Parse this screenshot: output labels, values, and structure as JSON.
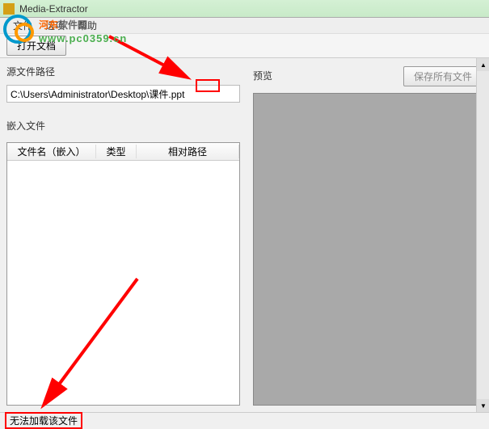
{
  "window": {
    "title": "Media-Extractor"
  },
  "menu": {
    "file": "文件",
    "options": "选项",
    "help": "帮助"
  },
  "toolbar": {
    "open_file": "打开文档",
    "save_all": "保存所有文件"
  },
  "left": {
    "source_path_label": "源文件路径",
    "source_path_value": "C:\\Users\\Administrator\\Desktop\\课件.ppt",
    "embedded_label": "嵌入文件",
    "columns": {
      "filename": "文件名（嵌入）",
      "type": "类型",
      "relpath": "相对路径"
    }
  },
  "right": {
    "preview_label": "预览"
  },
  "status": {
    "text": "无法加载该文件"
  },
  "watermark": {
    "name_a": "河东",
    "name_b": "软件园",
    "url": "www.pc0359.cn"
  }
}
